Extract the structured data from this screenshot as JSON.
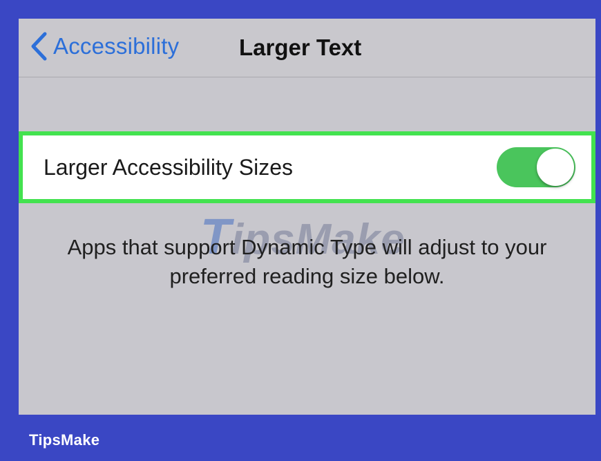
{
  "nav": {
    "back_label": "Accessibility",
    "title": "Larger Text"
  },
  "setting_row": {
    "label": "Larger Accessibility Sizes",
    "toggle_on": true
  },
  "footer_text": "Apps that support Dynamic Type will adjust to your preferred reading size below.",
  "watermark": {
    "big_letter": "T",
    "rest": "ipsMake"
  },
  "brand": "TipsMake",
  "colors": {
    "frame": "#3a47c4",
    "screen_bg": "#c8c7cd",
    "link_blue": "#2c6fd9",
    "toggle_green": "#4ac55c",
    "highlight_green": "#43e24f"
  },
  "icons": {
    "back": "chevron-left-icon"
  }
}
